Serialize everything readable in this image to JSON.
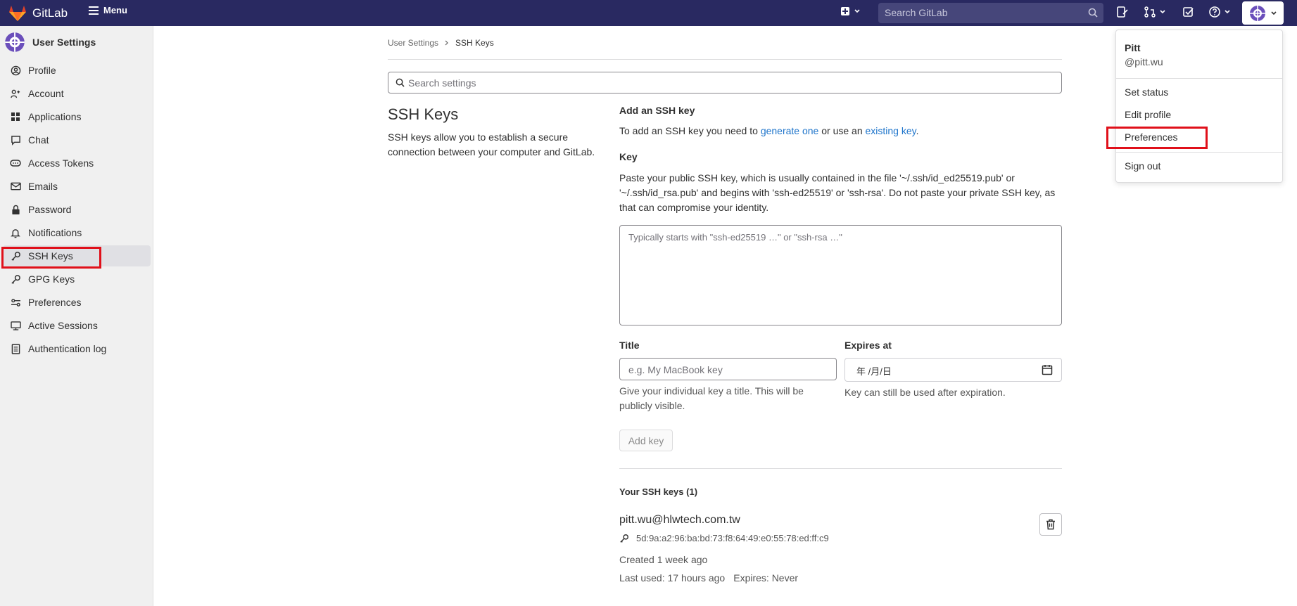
{
  "topbar": {
    "brand": "GitLab",
    "menu_label": "Menu",
    "search_placeholder": "Search GitLab"
  },
  "sidebar": {
    "title": "User Settings",
    "items": [
      {
        "label": "Profile",
        "icon": "profile-icon"
      },
      {
        "label": "Account",
        "icon": "account-icon"
      },
      {
        "label": "Applications",
        "icon": "applications-icon"
      },
      {
        "label": "Chat",
        "icon": "chat-icon"
      },
      {
        "label": "Access Tokens",
        "icon": "token-icon"
      },
      {
        "label": "Emails",
        "icon": "mail-icon"
      },
      {
        "label": "Password",
        "icon": "lock-icon"
      },
      {
        "label": "Notifications",
        "icon": "bell-icon"
      },
      {
        "label": "SSH Keys",
        "icon": "key-icon"
      },
      {
        "label": "GPG Keys",
        "icon": "key-icon"
      },
      {
        "label": "Preferences",
        "icon": "preferences-icon"
      },
      {
        "label": "Active Sessions",
        "icon": "monitor-icon"
      },
      {
        "label": "Authentication log",
        "icon": "log-icon"
      }
    ],
    "active": "SSH Keys"
  },
  "breadcrumb": {
    "parent": "User Settings",
    "current": "SSH Keys"
  },
  "search_settings_placeholder": "Search settings",
  "ssh": {
    "heading": "SSH Keys",
    "description": "SSH keys allow you to establish a secure connection between your computer and GitLab.",
    "add_title": "Add an SSH key",
    "add_help_prefix": "To add an SSH key you need to ",
    "add_help_link1": "generate one",
    "add_help_mid": " or use an ",
    "add_help_link2": "existing key",
    "add_help_suffix": ".",
    "key_label": "Key",
    "key_help": "Paste your public SSH key, which is usually contained in the file '~/.ssh/id_ed25519.pub' or '~/.ssh/id_rsa.pub' and begins with 'ssh-ed25519' or 'ssh-rsa'. Do not paste your private SSH key, as that can compromise your identity.",
    "key_placeholder": "Typically starts with \"ssh-ed25519 …\" or \"ssh-rsa …\"",
    "title_label": "Title",
    "title_placeholder": "e.g. My MacBook key",
    "title_help": "Give your individual key a title. This will be publicly visible.",
    "expires_label": "Expires at",
    "expires_value": "年 /月/日",
    "expires_help": "Key can still be used after expiration.",
    "add_key_button": "Add key",
    "your_keys": "Your SSH keys (1)",
    "key": {
      "name": "pitt.wu@hlwtech.com.tw",
      "fingerprint": "5d:9a:a2:96:ba:bd:73:f8:64:49:e0:55:78:ed:ff:c9",
      "created": "Created 1 week ago",
      "last_used": "Last used: 17 hours ago",
      "expires": "Expires: Never"
    }
  },
  "user_dropdown": {
    "name": "Pitt",
    "username": "@pitt.wu",
    "items": [
      "Set status",
      "Edit profile",
      "Preferences",
      "Sign out"
    ]
  },
  "colors": {
    "topbar": "#292961",
    "link": "#1f75cb",
    "highlight": "#e0101a"
  }
}
